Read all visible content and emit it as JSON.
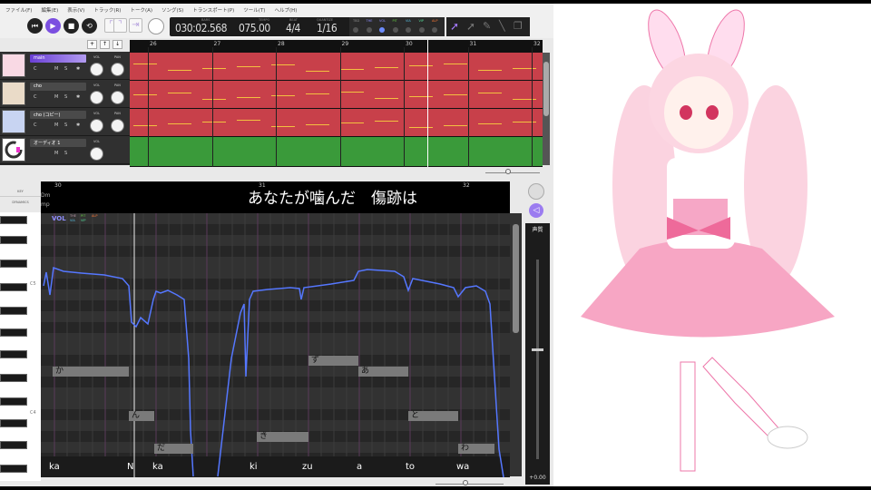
{
  "menu": [
    "ファイル(F)",
    "編集(E)",
    "表示(V)",
    "トラック(R)",
    "トーク(A)",
    "ソング(S)",
    "トランスポート(P)",
    "ツール(T)",
    "ヘルプ(H)"
  ],
  "transport": {
    "bars_label": "BARS",
    "time": "030:02.568",
    "tempo_label": "TEMPO",
    "tempo": "075.00",
    "beat_label": "BEAT",
    "beat": "4/4",
    "quantize_label": "QUANTIZE",
    "quantize": "1/16"
  },
  "params": [
    "TBD",
    "THE",
    "VOL",
    "PIT",
    "VIA",
    "VIP",
    "ALP"
  ],
  "param_colors": [
    "#888",
    "#8f8fff",
    "#8f8fff",
    "#66cc44",
    "#55bbdd",
    "#55dd99",
    "#ff7733"
  ],
  "tracks": [
    {
      "name": "main",
      "buttons": [
        "C",
        "M",
        "S",
        "✱"
      ],
      "vol": "VOL",
      "pan": "PAN",
      "selected": true
    },
    {
      "name": "cho",
      "buttons": [
        "C",
        "M",
        "S",
        "✱"
      ],
      "vol": "VOL",
      "pan": "PAN"
    },
    {
      "name": "cho (コピー)",
      "buttons": [
        "C",
        "M",
        "S",
        "✱"
      ],
      "vol": "VOL",
      "pan": "PAN"
    },
    {
      "name": "オーディオ 1",
      "buttons": [
        "",
        "M",
        "S",
        ""
      ],
      "vol": "VOL"
    }
  ],
  "track_add_buttons": [
    "+",
    "↑",
    "↓"
  ],
  "timeline_bars": [
    "26",
    "27",
    "28",
    "29",
    "30",
    "31",
    "32"
  ],
  "pianoroll": {
    "key_label": "KEY",
    "dynamics_label": "DYNAMICS",
    "key": "Dm",
    "dynamics": "mp",
    "bars": [
      "30",
      "31",
      "32"
    ],
    "lyrics_display": "あなたが噛んだ　傷跡は",
    "c5": "C5",
    "c4": "C4",
    "vol_label": "VOL",
    "mini_params": [
      "THE",
      "PIT",
      "ALP",
      "VIA",
      "VIP"
    ],
    "notes": [
      "か",
      "ん",
      "だ",
      "き",
      "ず",
      "あ",
      "と",
      "わ"
    ],
    "phonemes": [
      "ka",
      "N",
      "ka",
      "ki",
      "zu",
      "a",
      "to",
      "wa"
    ]
  },
  "voice_panel": {
    "label": "声質",
    "value": "+0.00"
  }
}
